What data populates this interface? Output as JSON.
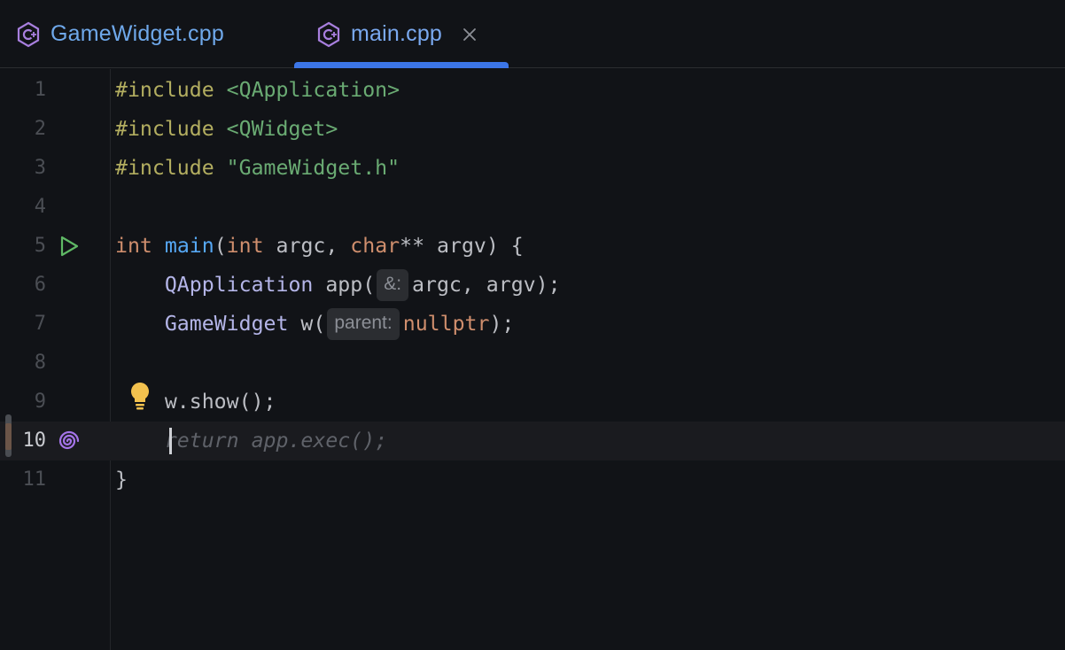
{
  "tabs": [
    {
      "label": "GameWidget.cpp",
      "icon": "cpp-file-icon",
      "active": false
    },
    {
      "label": "main.cpp",
      "icon": "cpp-file-icon",
      "active": true,
      "close_symbol": "✕"
    }
  ],
  "editor": {
    "current_line": 10,
    "lines": [
      {
        "number": "1"
      },
      {
        "number": "2"
      },
      {
        "number": "3"
      },
      {
        "number": "4"
      },
      {
        "number": "5"
      },
      {
        "number": "6"
      },
      {
        "number": "7"
      },
      {
        "number": "8"
      },
      {
        "number": "9"
      },
      {
        "number": "10"
      },
      {
        "number": "11"
      }
    ],
    "code": {
      "l1_directive": "#include",
      "l1_header": "<QApplication>",
      "l2_directive": "#include",
      "l2_header": "<QWidget>",
      "l3_directive": "#include",
      "l3_header": "\"GameWidget.h\"",
      "l5_ret_type": "int",
      "l5_fn": "main",
      "l5_open": "(",
      "l5_type1": "int",
      "l5_param1": " argc, ",
      "l5_type2": "char",
      "l5_rest": "** argv) {",
      "l6_indent": "    ",
      "l6_class": "QApplication",
      "l6_call": " app(",
      "l6_hint": "&:",
      "l6_rest": "argc, argv);",
      "l7_indent": "    ",
      "l7_class": "GameWidget",
      "l7_call": " w(",
      "l7_hint": "parent:",
      "l7_null": "nullptr",
      "l7_rest": ");",
      "l9_indent": "    ",
      "l9_code": "w.show();",
      "l10_indent": "    ",
      "l10_ghost": "return app.exec();",
      "l11_code": "}"
    },
    "gutter_icons": {
      "line5": "run-icon",
      "line9": "lightbulb-icon",
      "line10": "ai-completion-icon"
    },
    "colors": {
      "keyword": "#cf8e6d",
      "function": "#56a8f5",
      "preprocessor": "#b3ae60",
      "string": "#6aab73",
      "class": "#b4b5e8",
      "tab_accent": "#3c76e8"
    }
  }
}
